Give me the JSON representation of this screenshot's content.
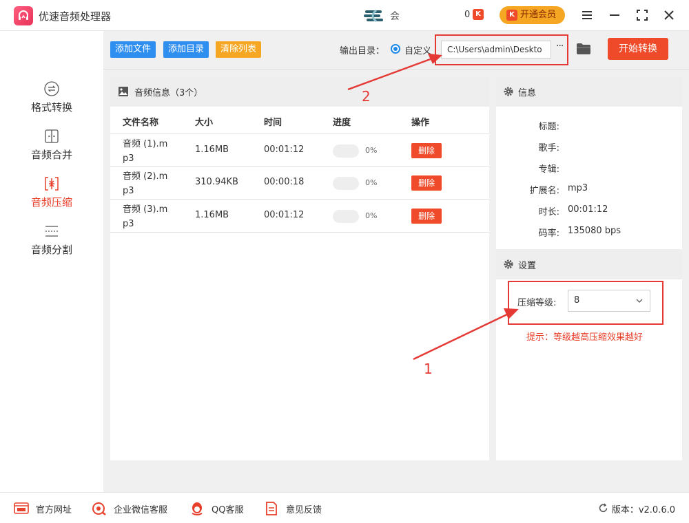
{
  "app": {
    "title": "优速音频处理器",
    "user_name": "会",
    "vip_count": "0",
    "vip_badge": "K",
    "vip_button": "开通会员"
  },
  "sidebar": {
    "items": [
      {
        "label": "格式转换",
        "icon": "format-convert-icon",
        "active": false
      },
      {
        "label": "音频合并",
        "icon": "merge-icon",
        "active": false
      },
      {
        "label": "音频压缩",
        "icon": "compress-icon",
        "active": true
      },
      {
        "label": "音频分割",
        "icon": "split-icon",
        "active": false
      }
    ]
  },
  "toolbar": {
    "add_file": "添加文件",
    "add_dir": "添加目录",
    "clear_list": "清除列表",
    "output_label": "输出目录：",
    "custom_label": "自定义",
    "output_path": "C:\\Users\\admin\\Deskto",
    "more": "···",
    "start": "开始转换"
  },
  "files": {
    "title": "音频信息（3个）",
    "columns": [
      "文件名称",
      "大小",
      "时间",
      "进度",
      "操作"
    ],
    "rows": [
      {
        "name": "音频 (1).mp3",
        "size": "1.16MB",
        "time": "00:01:12",
        "progress": 0,
        "progress_text": "0%",
        "action": "删除"
      },
      {
        "name": "音频 (2).mp3",
        "size": "310.94KB",
        "time": "00:00:18",
        "progress": 0,
        "progress_text": "0%",
        "action": "删除"
      },
      {
        "name": "音频 (3).mp3",
        "size": "1.16MB",
        "time": "00:01:12",
        "progress": 0,
        "progress_text": "0%",
        "action": "删除"
      }
    ]
  },
  "info": {
    "title": "信息",
    "fields": [
      {
        "key": "标题:",
        "value": ""
      },
      {
        "key": "歌手:",
        "value": ""
      },
      {
        "key": "专辑:",
        "value": ""
      },
      {
        "key": "扩展名:",
        "value": "mp3"
      },
      {
        "key": "时长:",
        "value": "00:01:12"
      },
      {
        "key": "码率:",
        "value": "135080 bps"
      }
    ]
  },
  "settings": {
    "title": "设置",
    "level_label": "压缩等级:",
    "level_value": "8",
    "hint": "提示：等级越高压缩效果越好"
  },
  "annotations": {
    "one": "1",
    "two": "2",
    "color": "#e53935"
  },
  "footer": {
    "website": "官方网址",
    "wechat": "企业微信客服",
    "qq": "QQ客服",
    "feedback": "意见反馈",
    "version": "版本：v2.0.6.0"
  },
  "colors": {
    "accent_red": "#ef4b2a",
    "blue_button": "#2f8ff0",
    "orange_button": "#f5a623"
  }
}
